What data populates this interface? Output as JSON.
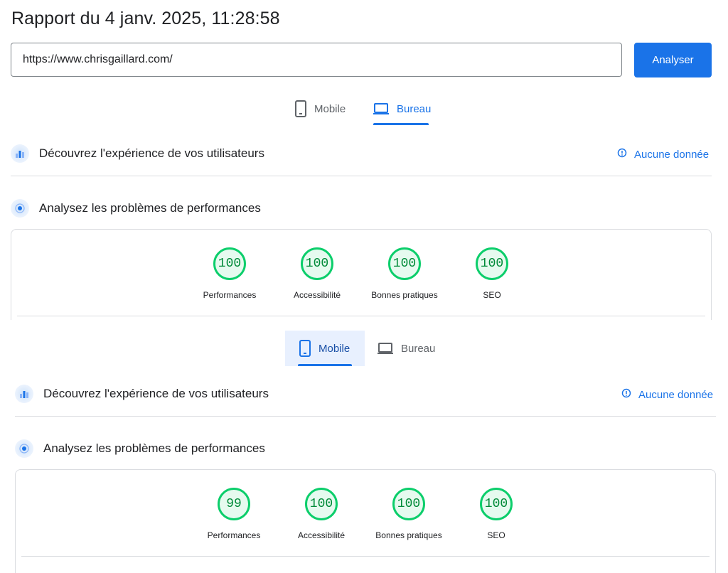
{
  "report_title": "Rapport du 4 janv. 2025, 11:28:58",
  "url_input": {
    "value": "https://www.chrisgaillard.com/"
  },
  "analyze_button": "Analyser",
  "panels": [
    {
      "tabs": {
        "mobile": "Mobile",
        "desktop": "Bureau",
        "active": "desktop"
      },
      "ux_section": {
        "title": "Découvrez l'expérience de vos utilisateurs",
        "status": "Aucune donnée"
      },
      "perf_section": {
        "title": "Analysez les problèmes de performances"
      },
      "scores": [
        {
          "label": "Performances",
          "value": "100"
        },
        {
          "label": "Accessibilité",
          "value": "100"
        },
        {
          "label": "Bonnes pratiques",
          "value": "100"
        },
        {
          "label": "SEO",
          "value": "100"
        }
      ]
    },
    {
      "tabs": {
        "mobile": "Mobile",
        "desktop": "Bureau",
        "active": "mobile"
      },
      "ux_section": {
        "title": "Découvrez l'expérience de vos utilisateurs",
        "status": "Aucune donnée"
      },
      "perf_section": {
        "title": "Analysez les problèmes de performances"
      },
      "scores": [
        {
          "label": "Performances",
          "value": "99"
        },
        {
          "label": "Accessibilité",
          "value": "100"
        },
        {
          "label": "Bonnes pratiques",
          "value": "100"
        },
        {
          "label": "SEO",
          "value": "100"
        }
      ]
    }
  ],
  "colors": {
    "accent": "#1a73e8",
    "pass": "#0cce6b",
    "pass_text": "#008a38"
  }
}
